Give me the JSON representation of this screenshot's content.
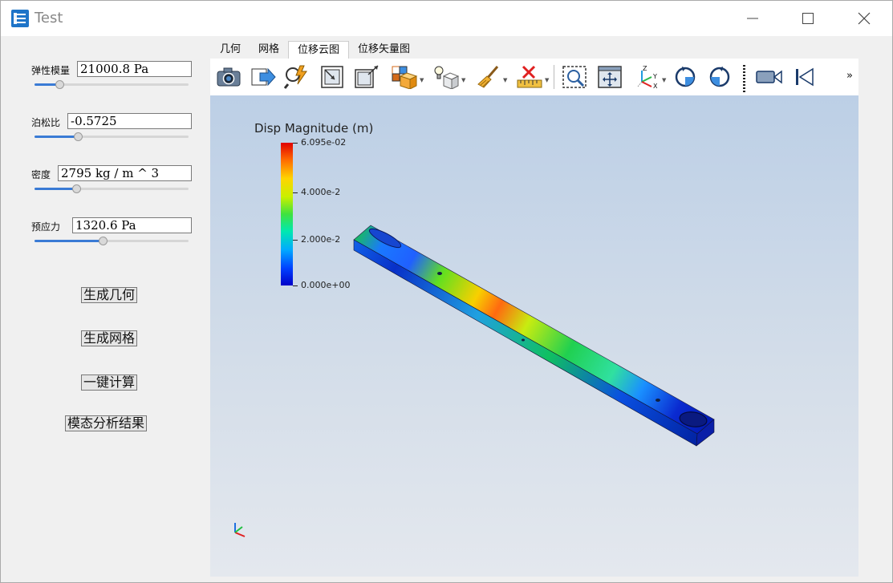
{
  "window": {
    "title": "Test"
  },
  "params": [
    {
      "label": "弹性模量",
      "value": "21000.8 Pa",
      "slider": 0.16
    },
    {
      "label": "泊松比",
      "value": "-0.5725",
      "slider": 0.28
    },
    {
      "label": "密度",
      "value": "2795 kg / m ^ 3",
      "slider": 0.27
    },
    {
      "label": "预应力",
      "value": "1320.6 Pa",
      "slider": 0.44
    }
  ],
  "actions": [
    "生成几何",
    "生成网格",
    "一键计算",
    "模态分析结果"
  ],
  "tabs": [
    {
      "label": "几何",
      "active": false
    },
    {
      "label": "网格",
      "active": false
    },
    {
      "label": "位移云图",
      "active": true
    },
    {
      "label": "位移矢量图",
      "active": false
    }
  ],
  "toolbar": {
    "icons": [
      "camera-icon",
      "export-icon",
      "query-icon",
      "select-cells-icon",
      "select-points-icon",
      "hover-cells-icon",
      "light-icon",
      "clear-icon",
      "ruler-icon",
      "zoom-box-icon",
      "reset-view-icon",
      "axes-orient-icon",
      "rotate-cw-icon",
      "rotate-ccw-icon",
      "video-icon",
      "first-frame-icon"
    ],
    "more": "»"
  },
  "legend": {
    "title": "Disp Magnitude (m)",
    "labels": [
      "6.095e-02",
      "4.000e-2",
      "2.000e-2",
      "0.000e+00"
    ],
    "colors": [
      "#0000c8",
      "#00aaff",
      "#3fe23f",
      "#ffd400",
      "#e00000"
    ]
  }
}
